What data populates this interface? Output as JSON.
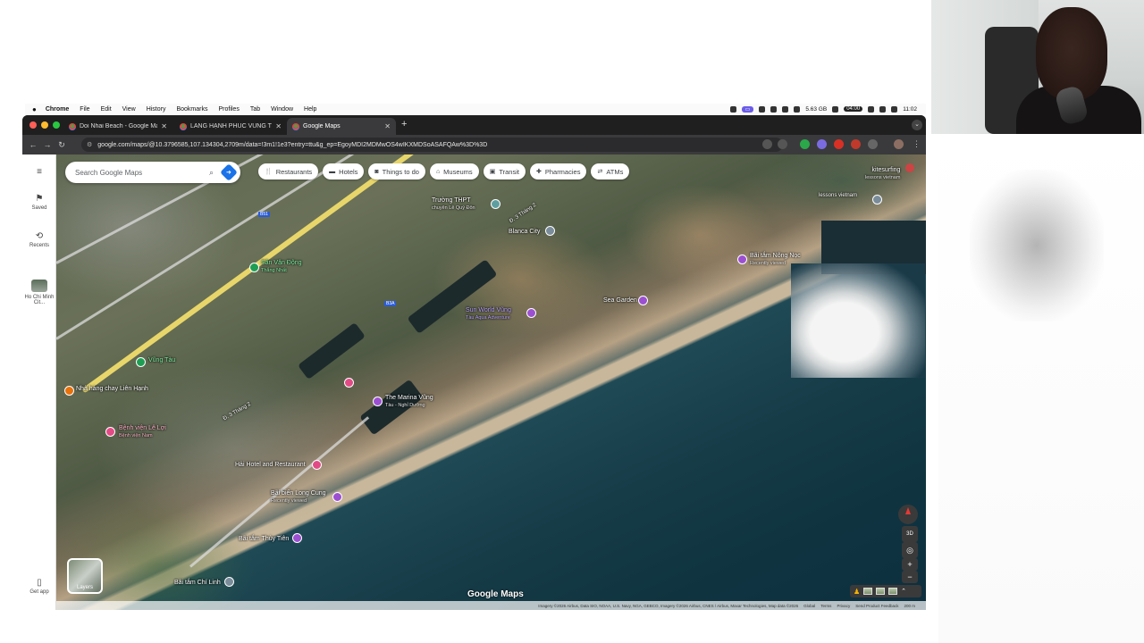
{
  "menubar": {
    "app_name": "Chrome",
    "items": [
      "File",
      "Edit",
      "View",
      "History",
      "Bookmarks",
      "Profiles",
      "Tab",
      "Window",
      "Help"
    ],
    "storage": "5.63 GB",
    "timer": "04:00",
    "clock": "11:02"
  },
  "browser": {
    "tabs": [
      {
        "title": "Doi Nhai Beach - Google Maps",
        "active": false
      },
      {
        "title": "LÀNG HẠNH PHÚC VŨNG TÀU",
        "active": false
      },
      {
        "title": "Google Maps",
        "active": true
      }
    ],
    "url": "google.com/maps/@10.3796585,107.134304,2709m/data=!3m1!1e3?entry=ttu&g_ep=EgoyMDI2MDMwOS4wIKXMDSoASAFQAw%3D%3D"
  },
  "maps": {
    "sidebar": {
      "saved": "Saved",
      "recents": "Recents",
      "recent_place": "Ho Chi Minh Cit...",
      "get_app": "Get app"
    },
    "search_placeholder": "Search Google Maps",
    "chips": [
      {
        "label": "Restaurants",
        "icon": "fork-knife-icon"
      },
      {
        "label": "Hotels",
        "icon": "bed-icon"
      },
      {
        "label": "Things to do",
        "icon": "camera-icon"
      },
      {
        "label": "Museums",
        "icon": "museum-icon"
      },
      {
        "label": "Transit",
        "icon": "train-icon"
      },
      {
        "label": "Pharmacies",
        "icon": "pharmacy-icon"
      },
      {
        "label": "ATMs",
        "icon": "atm-icon"
      }
    ],
    "places": {
      "p1": "Trường THPT",
      "p1b": "chuyên Lê Quý Đôn",
      "p2": "Blanca City",
      "p3": "kitesurfing",
      "p3b": "lessons vietnam",
      "p4": "Bãi tắm Nông Nọc",
      "p4sub": "Recently viewed",
      "p5": "Sân Vận Động",
      "p5b": "Thắng Nhất",
      "p6": "Sea Garden",
      "p7": "Sun World Vũng",
      "p7b": "Tàu Aqua Adventure",
      "p8": "Vũng Tàu",
      "p9": "Nhà hàng chay Liên Hạnh",
      "p10": "The Marina Vũng",
      "p10b": "Tàu - Nghỉ Dưỡng",
      "p11": "Bệnh viện Lê Lợi",
      "p11b": "Bệnh viện Nam",
      "p12": "Hải Hotel and Restaurant",
      "p13": "Bãi biển Long Cung",
      "p13sub": "Recently viewed",
      "p14": "Bãi tắm Thùy Tiên",
      "p15": "Bãi tắm Chí Linh",
      "road1": "Đ. 3 Tháng 2",
      "road2": "Đ. 3 Tháng 2"
    },
    "layers": "Layers",
    "brand": "Google Maps",
    "attribution": [
      "Imagery ©2026 Airbus, Data SIO, NOAA, U.S. Navy, NGA, GEBCO, Imagery ©2026 Airbus, CNES / Airbus, Maxar Technologies, Map data ©2026",
      "Global",
      "Terms",
      "Privacy",
      "Send Product Feedback",
      "200 m"
    ],
    "controls": {
      "tilt": "3D"
    }
  },
  "colors": {
    "map_pin_purple": "#9c4fd1",
    "map_pin_green": "#1e9e53",
    "map_pin_pink": "#e24a86",
    "map_pin_orange": "#e8710a",
    "direction_blue": "#1a73e8"
  }
}
